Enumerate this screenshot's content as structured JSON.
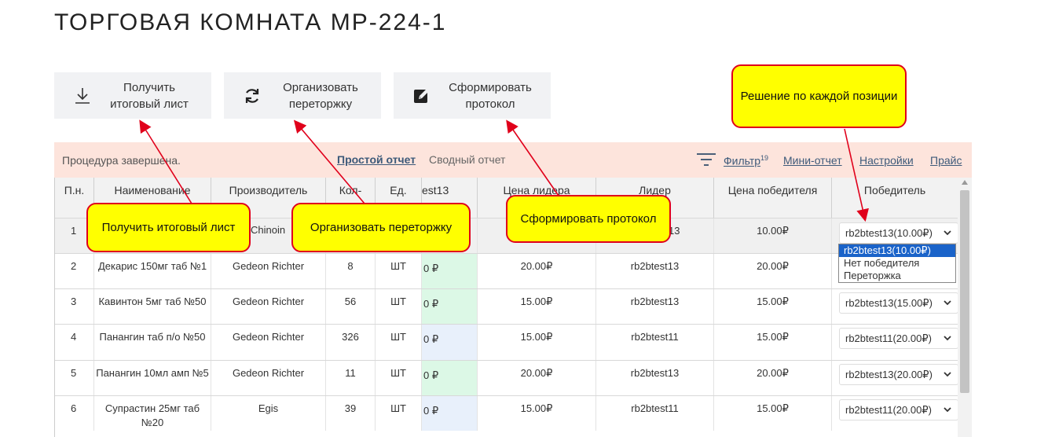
{
  "page": {
    "title": "ТОРГОВАЯ КОМНАТА МР-224-1"
  },
  "toolbar": {
    "final_sheet": {
      "label": "Получить\nитоговый лист",
      "icon": "download-icon"
    },
    "rebid": {
      "label": "Организовать\nпереторжку",
      "icon": "refresh-icon"
    },
    "protocol": {
      "label": "Сформировать\nпротокол",
      "icon": "edit-icon"
    }
  },
  "statusbar": {
    "status": "Процедура завершена.",
    "tabs": [
      "Простой отчет",
      "Сводный отчет"
    ],
    "filter_label": "Фильтр",
    "filter_count": "19",
    "mini_report": "Мини-отчет",
    "settings": "Настройки",
    "price": "Прайс"
  },
  "table": {
    "headers": [
      "П.н.",
      "Наименование",
      "Производитель",
      "Кол-",
      "Ед.",
      "est13",
      "Цена лидера",
      "Лидер",
      "Цена победителя",
      "Победитель"
    ],
    "rows": [
      {
        "n": "1",
        "name": "",
        "maker": "Chinoin",
        "qty": "",
        "unit": "",
        "bid": "",
        "leader_price": "",
        "leader": "13",
        "winner_price": "10.00₽",
        "winner": "rb2btest13(10.00₽)"
      },
      {
        "n": "2",
        "name": "Декарис 150мг таб №1",
        "maker": "Gedeon Richter",
        "qty": "8",
        "unit": "ШТ",
        "bid": "0 ₽",
        "leader_price": "20.00₽",
        "leader": "rb2btest13",
        "winner_price": "20.00₽",
        "winner": ""
      },
      {
        "n": "3",
        "name": "Кавинтон 5мг таб №50",
        "maker": "Gedeon Richter",
        "qty": "56",
        "unit": "ШТ",
        "bid": "0 ₽",
        "leader_price": "15.00₽",
        "leader": "rb2btest13",
        "winner_price": "15.00₽",
        "winner": "rb2btest13(15.00₽)"
      },
      {
        "n": "4",
        "name": "Панангин таб п/о №50",
        "maker": "Gedeon Richter",
        "qty": "326",
        "unit": "ШТ",
        "bid": "0 ₽",
        "leader_price": "15.00₽",
        "leader": "rb2btest11",
        "winner_price": "15.00₽",
        "winner": "rb2btest11(20.00₽)"
      },
      {
        "n": "5",
        "name": "Панангин 10мл амп №5",
        "maker": "Gedeon Richter",
        "qty": "11",
        "unit": "ШТ",
        "bid": "0 ₽",
        "leader_price": "20.00₽",
        "leader": "rb2btest13",
        "winner_price": "20.00₽",
        "winner": "rb2btest13(20.00₽)"
      },
      {
        "n": "6",
        "name": "Супрастин 25мг таб №20",
        "maker": "Egis",
        "qty": "39",
        "unit": "ШТ",
        "bid": "0 ₽",
        "leader_price": "15.00₽",
        "leader": "rb2btest11",
        "winner_price": "15.00₽",
        "winner": "rb2btest11(20.00₽)"
      }
    ]
  },
  "dropdown": {
    "options": [
      "rb2btest13(10.00₽)",
      "Нет победителя",
      "Переторжка"
    ],
    "selected_index": 0
  },
  "callouts": {
    "final": "Получить итоговый лист",
    "rebid": "Организовать переторжку",
    "protocol": "Сформировать протокол",
    "decision": "Решение по каждой позиции"
  },
  "colors": {
    "callout_fill": "#ffff00",
    "callout_border": "#e0001b",
    "status_bg": "#fde4dc",
    "bid_green": "#dcf8e6",
    "bid_blue": "#e8f0fb",
    "link": "#3d5a7a",
    "dropdown_selected": "#1a63c9"
  }
}
